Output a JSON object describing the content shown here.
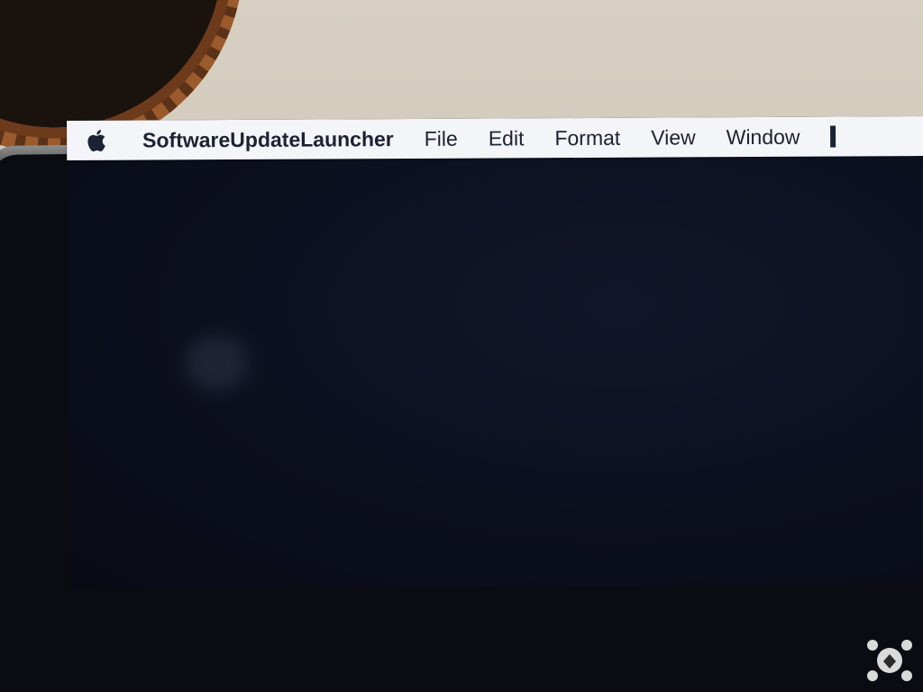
{
  "menubar": {
    "apple_menu_icon": "apple-logo-icon",
    "app_name": "SoftwareUpdateLauncher",
    "items": [
      {
        "label": "File"
      },
      {
        "label": "Edit"
      },
      {
        "label": "Format"
      },
      {
        "label": "View"
      },
      {
        "label": "Window"
      }
    ]
  },
  "colors": {
    "menubar_background": "#f4f5f8",
    "menubar_text": "#1b2233",
    "screen_background": "#0c0f1e",
    "bezel": "#0b0c11"
  }
}
